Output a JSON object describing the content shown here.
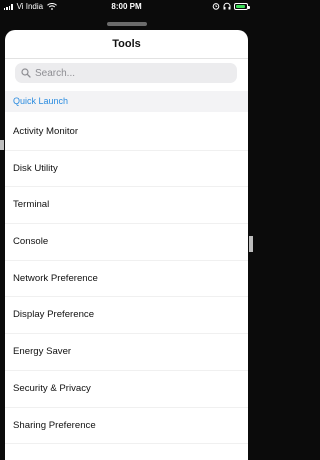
{
  "status_bar": {
    "carrier": "Vi India",
    "time": "8:00 PM",
    "battery_color": "#3ddc5a"
  },
  "sheet": {
    "title": "Tools",
    "search": {
      "placeholder": "Search..."
    },
    "section_header": "Quick Launch",
    "items": [
      {
        "label": "Activity Monitor"
      },
      {
        "label": "Disk Utility"
      },
      {
        "label": "Terminal"
      },
      {
        "label": "Console"
      },
      {
        "label": "Network Preference"
      },
      {
        "label": "Display Preference"
      },
      {
        "label": "Energy Saver"
      },
      {
        "label": "Security & Privacy"
      },
      {
        "label": "Sharing Preference"
      }
    ]
  },
  "colors": {
    "accent": "#2b8ce0",
    "backdrop": "#0b0b0b",
    "search_bg": "#ececee"
  }
}
